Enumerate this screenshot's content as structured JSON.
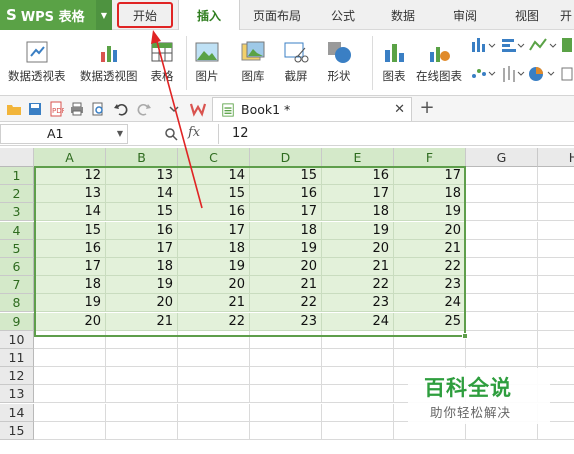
{
  "app": {
    "name": "WPS 表格",
    "logo": "S"
  },
  "menu_tabs": [
    {
      "label": "开始"
    },
    {
      "label": "插入"
    },
    {
      "label": "页面布局"
    },
    {
      "label": "公式"
    },
    {
      "label": "数据"
    },
    {
      "label": "审阅"
    },
    {
      "label": "视图"
    },
    {
      "label": "开"
    }
  ],
  "ribbon": {
    "pivot_table": "数据透视表",
    "pivot_chart": "数据透视图",
    "table": "表格",
    "picture": "图片",
    "gallery": "图库",
    "screenshot": "截屏",
    "shapes": "形状",
    "chart": "图表",
    "online_chart": "在线图表"
  },
  "document": {
    "tab_title": "Book1 *",
    "new_tab": "+"
  },
  "formula_bar": {
    "name_box": "A1",
    "fx_label": "fx",
    "value": "12"
  },
  "columns": [
    "A",
    "B",
    "C",
    "D",
    "E",
    "F",
    "G",
    "H"
  ],
  "rows": [
    "1",
    "2",
    "3",
    "4",
    "5",
    "6",
    "7",
    "8",
    "9",
    "10",
    "11",
    "12",
    "13",
    "14",
    "15"
  ],
  "cells": [
    [
      "12",
      "13",
      "14",
      "15",
      "16",
      "17"
    ],
    [
      "13",
      "14",
      "15",
      "16",
      "17",
      "18"
    ],
    [
      "14",
      "15",
      "16",
      "17",
      "18",
      "19"
    ],
    [
      "15",
      "16",
      "17",
      "18",
      "19",
      "20"
    ],
    [
      "16",
      "17",
      "18",
      "19",
      "20",
      "21"
    ],
    [
      "17",
      "18",
      "19",
      "20",
      "21",
      "22"
    ],
    [
      "18",
      "19",
      "20",
      "21",
      "22",
      "23"
    ],
    [
      "19",
      "20",
      "21",
      "22",
      "23",
      "24"
    ],
    [
      "20",
      "21",
      "22",
      "23",
      "24",
      "25"
    ]
  ],
  "watermark": {
    "title": "百科全说",
    "subtitle": "助你轻松解决"
  },
  "colors": {
    "accent": "#5aa246",
    "selection": "#e3f1da",
    "highlight_box": "#e02424"
  }
}
